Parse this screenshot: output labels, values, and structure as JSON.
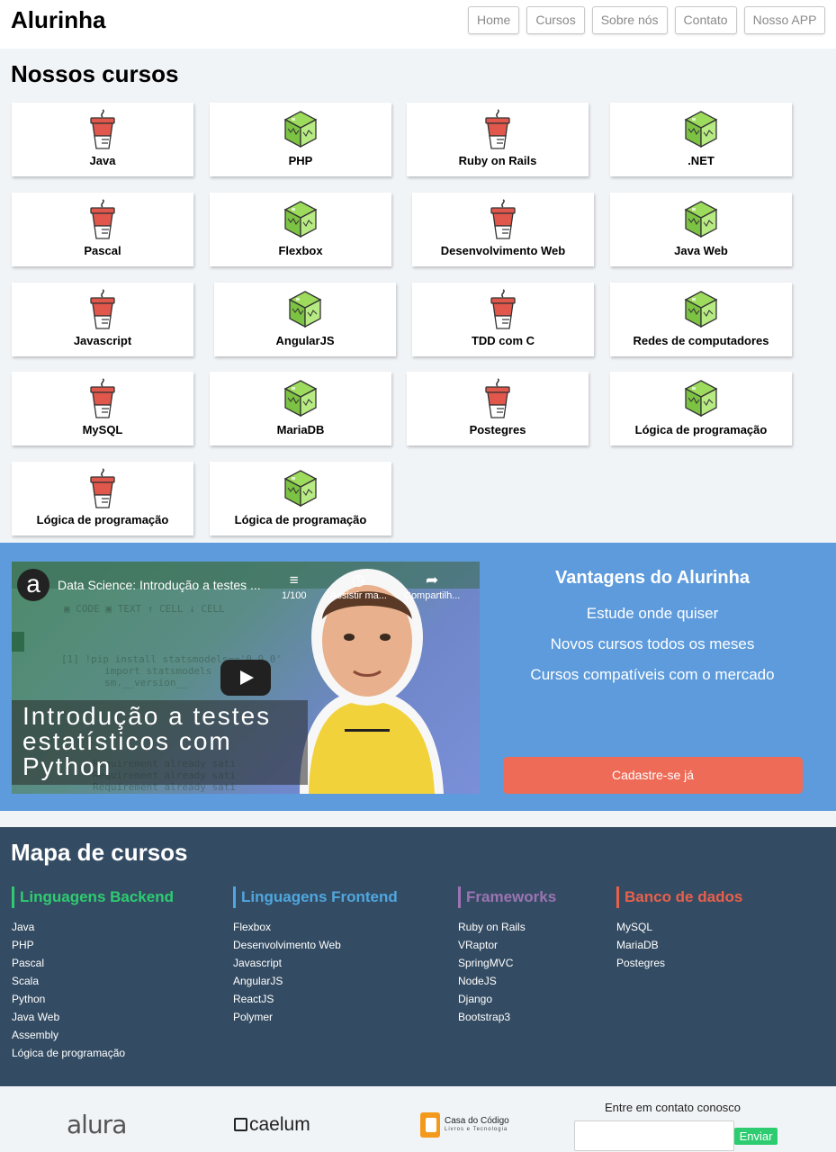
{
  "header": {
    "logo": "Alurinha",
    "nav": [
      "Home",
      "Cursos",
      "Sobre nós",
      "Contato",
      "Nosso APP"
    ]
  },
  "courses": {
    "title": "Nossos cursos",
    "items": [
      {
        "name": "Java",
        "icon": "cup-icon"
      },
      {
        "name": "PHP",
        "icon": "cube-icon"
      },
      {
        "name": "Ruby on Rails",
        "icon": "cup-icon"
      },
      {
        "name": ".NET",
        "icon": "cube-icon"
      },
      {
        "name": "Pascal",
        "icon": "cup-icon"
      },
      {
        "name": "Flexbox",
        "icon": "cube-icon"
      },
      {
        "name": "Desenvolvimento Web",
        "icon": "cup-icon"
      },
      {
        "name": "Java Web",
        "icon": "cube-icon"
      },
      {
        "name": "Javascript",
        "icon": "cup-icon"
      },
      {
        "name": "AngularJS",
        "icon": "cube-icon"
      },
      {
        "name": "TDD com C",
        "icon": "cup-icon"
      },
      {
        "name": "Redes de computadores",
        "icon": "cube-icon"
      },
      {
        "name": "MySQL",
        "icon": "cup-icon"
      },
      {
        "name": "MariaDB",
        "icon": "cube-icon"
      },
      {
        "name": "Postegres",
        "icon": "cup-icon"
      },
      {
        "name": "Lógica de programação",
        "icon": "cube-icon"
      },
      {
        "name": "Lógica de programação",
        "icon": "cup-icon"
      },
      {
        "name": "Lógica de programação",
        "icon": "cube-icon"
      }
    ]
  },
  "video": {
    "channel_logo": "a",
    "title": "Data Science: Introdução a testes ...",
    "playlist_label": "1/100",
    "watch_label": "Assistir ma...",
    "share_label": "Compartilh...",
    "overlay_text": "Introdução a testes\nestatísticos com\nPython"
  },
  "advantages": {
    "title": "Vantagens do Alurinha",
    "items": [
      "Estude onde quiser",
      "Novos cursos todos os meses",
      "Cursos compatíveis com o mercado"
    ],
    "cta_label": "Cadastre-se já"
  },
  "course_map": {
    "title": "Mapa de cursos",
    "columns": [
      {
        "title": "Linguagens Backend",
        "color": "#2ecc71",
        "items": [
          "Java",
          "PHP",
          "Pascal",
          "Scala",
          "Python",
          "Java Web",
          "Assembly",
          "Lógica de programação"
        ]
      },
      {
        "title": "Linguagens Frontend",
        "color": "#4fa7e0",
        "items": [
          "Flexbox",
          "Desenvolvimento Web",
          "Javascript",
          "AngularJS",
          "ReactJS",
          "Polymer"
        ]
      },
      {
        "title": "Frameworks",
        "color": "#9b74b3",
        "items": [
          "Ruby on Rails",
          "VRaptor",
          "SpringMVC",
          "NodeJS",
          "Django",
          "Bootstrap3"
        ]
      },
      {
        "title": "Banco de dados",
        "color": "#e8604c",
        "items": [
          "MySQL",
          "MariaDB",
          "Postegres"
        ]
      }
    ]
  },
  "footer": {
    "brands": [
      "alura",
      "caelum",
      "Casa do Código",
      "Livros e Tecnologia"
    ],
    "contact_label": "Entre em contato conosco",
    "contact_placeholder": "",
    "send_label": "Enviar"
  },
  "colors": {
    "banner": "#5d9bdc",
    "cta": "#ee6b57",
    "map_bg": "#344c63",
    "send": "#2ecc71"
  }
}
